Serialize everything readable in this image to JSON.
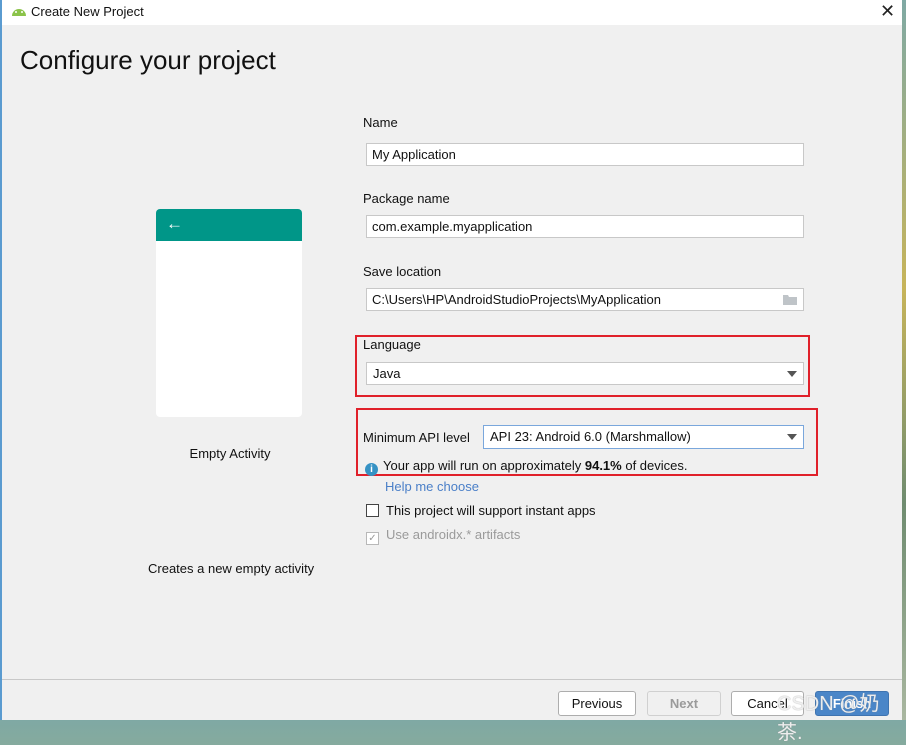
{
  "window": {
    "title": "Create New Project",
    "icon": "android-icon"
  },
  "page": {
    "heading": "Configure your project"
  },
  "preview": {
    "template_name": "Empty Activity",
    "description": "Creates a new empty activity",
    "back_arrow": "←"
  },
  "form": {
    "name_label": "Name",
    "name_value": "My Application",
    "package_label": "Package name",
    "package_value": "com.example.myapplication",
    "save_label": "Save location",
    "save_value": "C:\\Users\\HP\\AndroidStudioProjects\\MyApplication",
    "language_label": "Language",
    "language_value": "Java",
    "api_label": "Minimum API level",
    "api_value": "API 23: Android 6.0 (Marshmallow)",
    "info_prefix": "Your app will run on approximately ",
    "info_percent": "94.1%",
    "info_suffix": " of devices.",
    "help_link": "Help me choose",
    "instant_apps_label": "This project will support instant apps",
    "instant_apps_checked": false,
    "androidx_label": "Use androidx.* artifacts",
    "androidx_checked": true
  },
  "buttons": {
    "previous": "Previous",
    "next": "Next",
    "cancel": "Cancel",
    "finish": "Finish"
  },
  "watermark": "CSDN @奶茶.",
  "colors": {
    "accent": "#009688",
    "highlight": "#e0202a",
    "primary_button": "#4a86c8",
    "link": "#4a7fc8"
  }
}
